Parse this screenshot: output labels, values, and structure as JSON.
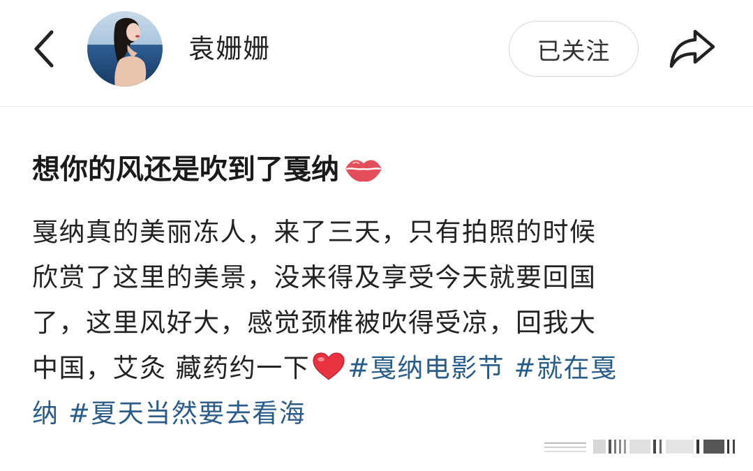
{
  "header": {
    "username": "袁姗姗",
    "follow_label": "已关注",
    "back_icon": "chevron-left-icon",
    "share_icon": "share-arrow-icon"
  },
  "post": {
    "title": "想你的风还是吹到了戛纳",
    "title_emoji": "lips-icon",
    "body_lines": [
      "戛纳真的美丽冻人，来了三天，只有拍照的时候",
      "欣赏了这里的美景，没来得及享受今天就要回国",
      "了，这里风好大，感觉颈椎被吹得受凉，回我大"
    ],
    "line4_text": "中国，艾灸 藏药约一下",
    "line4_emoji": "heart-icon",
    "hashtags": [
      "#戛纳电影节",
      "#就在戛纳",
      "#夏天当然要去看海"
    ],
    "hashtag2_part1": "#就在戛",
    "hashtag2_part2": "纳",
    "colors": {
      "hashtag": "#2a5c8a",
      "text": "#222222",
      "border": "#d6d6d6"
    }
  }
}
